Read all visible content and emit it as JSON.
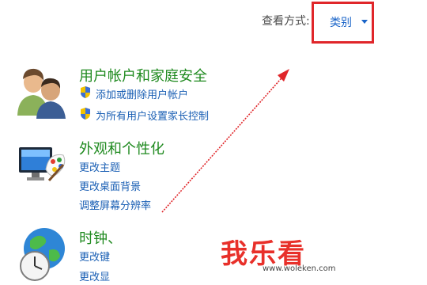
{
  "header": {
    "view_by_label": "查看方式:",
    "category_label": "类别"
  },
  "sections": [
    {
      "title": "用户帐户和家庭安全",
      "links": [
        "添加或删除用户帐户",
        "为所有用户设置家长控制"
      ],
      "icon": "users-icon"
    },
    {
      "title": "外观和个性化",
      "links": [
        "更改主题",
        "更改桌面背景",
        "调整屏幕分辨率"
      ],
      "icon": "appearance-icon"
    },
    {
      "title": "时钟、",
      "links": [
        "更改键",
        "更改显"
      ],
      "icon": "clock-globe-icon"
    }
  ],
  "watermark": {
    "text": "我乐看",
    "url": "www.woleken.com"
  },
  "colors": {
    "highlight_box": "#e0262a",
    "section_title": "#1f8a1f",
    "link": "#1a5fb4"
  }
}
